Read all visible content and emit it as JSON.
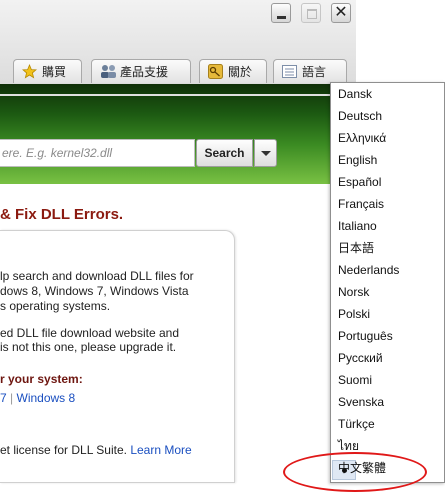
{
  "window": {
    "buttons": {
      "min_icon": "minimize-icon",
      "max_icon": "maximize-icon",
      "close_glyph": "✕"
    }
  },
  "toolbar": {
    "buy": {
      "label": "購買",
      "icon": "star-icon"
    },
    "support": {
      "label": "產品支援",
      "icon": "people-icon"
    },
    "about": {
      "label": "關於",
      "icon": "key-icon"
    },
    "language": {
      "label": "語言",
      "icon": "list-icon"
    }
  },
  "search": {
    "placeholder": "ere. E.g. kernel32.dll",
    "button_label": "Search"
  },
  "content": {
    "headline": "& Fix DLL Errors.",
    "para1": [
      "lp search and download DLL files for",
      "dows 8, Windows 7, Windows Vista",
      "s operating systems."
    ],
    "para2": [
      "ed DLL file download website and",
      "is not this one, please upgrade it."
    ],
    "system_heading": "r your system:",
    "os_link_7": "7",
    "os_sep": "|",
    "os_link_8": "Windows 8",
    "license_text": "et license for DLL Suite.",
    "learn_more": "Learn More"
  },
  "language_menu": {
    "items": [
      "Dansk",
      "Deutsch",
      "Ελληνικά",
      "English",
      "Español",
      "Français",
      "Italiano",
      "日本語",
      "Nederlands",
      "Norsk",
      "Polski",
      "Português",
      "Русский",
      "Suomi",
      "Svenska",
      "Türkçe",
      "ไทย",
      "中文繁體"
    ],
    "selected": "中文繁體"
  },
  "colors": {
    "headline": "#8b1a10",
    "link": "#1a4fc0",
    "highlight_ring": "#e01818",
    "band": "#3a8a22"
  }
}
